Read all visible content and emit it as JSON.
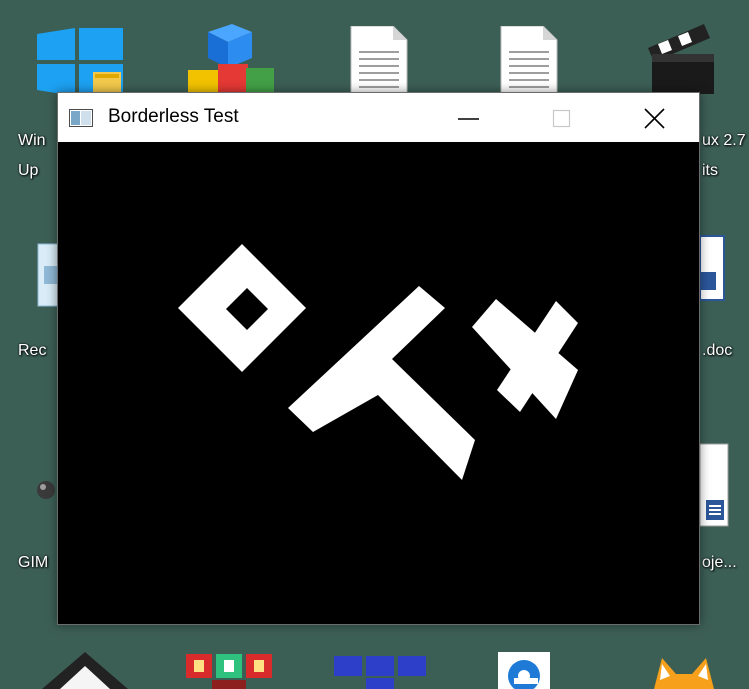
{
  "window": {
    "title": "Borderless Test",
    "client_background": "#000000",
    "logo": "orx-logo"
  },
  "desktop": {
    "background": "#3c5f55",
    "icons": [
      {
        "icon": "windows-update-icon",
        "label": "Win"
      },
      {
        "icon": "windows-update-icon",
        "label": "Up"
      },
      {
        "icon": "recycle-bin-icon",
        "label": "Rec"
      },
      {
        "icon": "gimp-icon",
        "label": "GIM"
      },
      {
        "icon": "clapperboard-icon",
        "label": "ux 2.7"
      },
      {
        "icon": "clapperboard-icon",
        "label": "its"
      },
      {
        "icon": "word-document-icon",
        "label": ".doc"
      },
      {
        "icon": "project-document-icon",
        "label": "oje..."
      }
    ]
  }
}
